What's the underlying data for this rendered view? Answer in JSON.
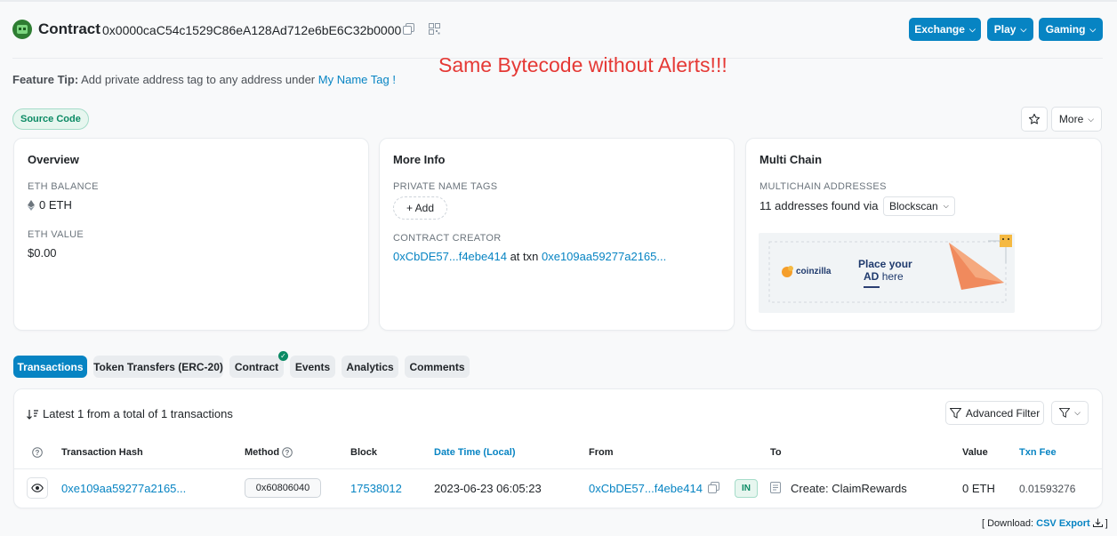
{
  "header": {
    "title": "Contract",
    "address": "0x0000caC54c1529C86eA128Ad712e6bE6C32b0000",
    "buttons": [
      {
        "label": "Exchange"
      },
      {
        "label": "Play"
      },
      {
        "label": "Gaming"
      }
    ]
  },
  "tip": {
    "prefix": "Feature Tip:",
    "text": "Add private address tag to any address under",
    "link": "My Name Tag !"
  },
  "overlay_text": "Same Bytecode without Alerts!!!",
  "source_badge": "Source Code",
  "more_label": "More",
  "overview": {
    "title": "Overview",
    "eth_balance_label": "ETH BALANCE",
    "eth_balance": "0 ETH",
    "eth_value_label": "ETH VALUE",
    "eth_value": "$0.00"
  },
  "more_info": {
    "title": "More Info",
    "private_tags_label": "PRIVATE NAME TAGS",
    "add_label": "+ Add",
    "creator_label": "CONTRACT CREATOR",
    "creator_address": "0xCbDE57...f4ebe414",
    "creator_at": "at txn",
    "creator_txn": "0xe109aa59277a2165..."
  },
  "multi_chain": {
    "title": "Multi Chain",
    "label": "MULTICHAIN ADDRESSES",
    "found_text": "11 addresses found via",
    "select": "Blockscan",
    "ad": {
      "brand": "coinzilla",
      "line1": "Place your",
      "line2_bold": "AD",
      "line2_rest": "here"
    }
  },
  "tabs": [
    {
      "label": "Transactions",
      "active": true
    },
    {
      "label": "Token Transfers (ERC-20)",
      "active": false
    },
    {
      "label": "Contract",
      "active": false
    },
    {
      "label": "Events",
      "active": false
    },
    {
      "label": "Analytics",
      "active": false
    },
    {
      "label": "Comments",
      "active": false
    }
  ],
  "transactions": {
    "summary": "Latest 1 from a total of 1 transactions",
    "advanced_filter": "Advanced Filter",
    "columns": [
      "Transaction Hash",
      "Method",
      "Block",
      "Date Time (Local)",
      "From",
      "To",
      "Value",
      "Txn Fee"
    ],
    "rows": [
      {
        "hash": "0xe109aa59277a2165...",
        "method": "0x60806040",
        "block": "17538012",
        "datetime": "2023-06-23 06:05:23",
        "from": "0xCbDE57...f4ebe414",
        "direction": "IN",
        "to": "Create: ClaimRewards",
        "value": "0 ETH",
        "fee": "0.01593276"
      }
    ]
  },
  "footer": {
    "open": "[ Download:",
    "link": "CSV Export",
    "close": "]"
  }
}
